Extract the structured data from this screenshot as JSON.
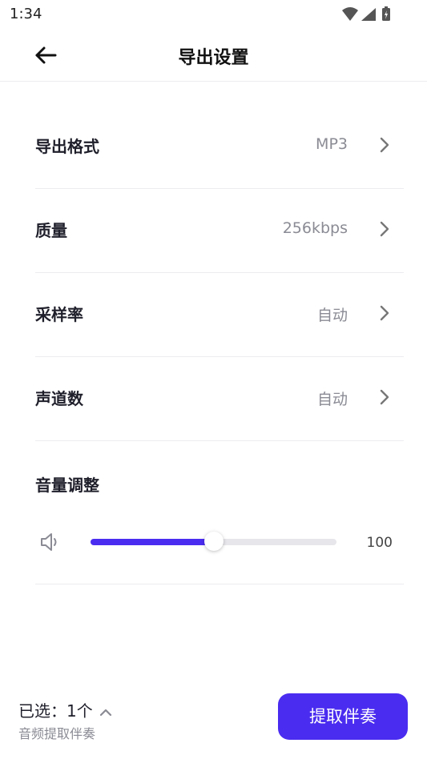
{
  "status": {
    "time": "1:34"
  },
  "header": {
    "title": "导出设置"
  },
  "settings": [
    {
      "label": "导出格式",
      "value": "MP3"
    },
    {
      "label": "质量",
      "value": "256kbps"
    },
    {
      "label": "采样率",
      "value": "自动"
    },
    {
      "label": "声道数",
      "value": "自动"
    }
  ],
  "volume": {
    "title": "音量调整",
    "value": "100",
    "slider_fraction": 0.5
  },
  "bottom": {
    "selected_label": "已选：1个",
    "subtitle": "音频提取伴奏",
    "action_label": "提取伴奏"
  },
  "colors": {
    "accent": "#4a2cf0",
    "track": "#e6e6eb",
    "muted_text": "#8a8b94"
  },
  "icons": {
    "back": "arrow-left-icon",
    "chevron": "chevron-right-icon",
    "speaker": "speaker-icon",
    "caret": "chevron-up-icon"
  }
}
